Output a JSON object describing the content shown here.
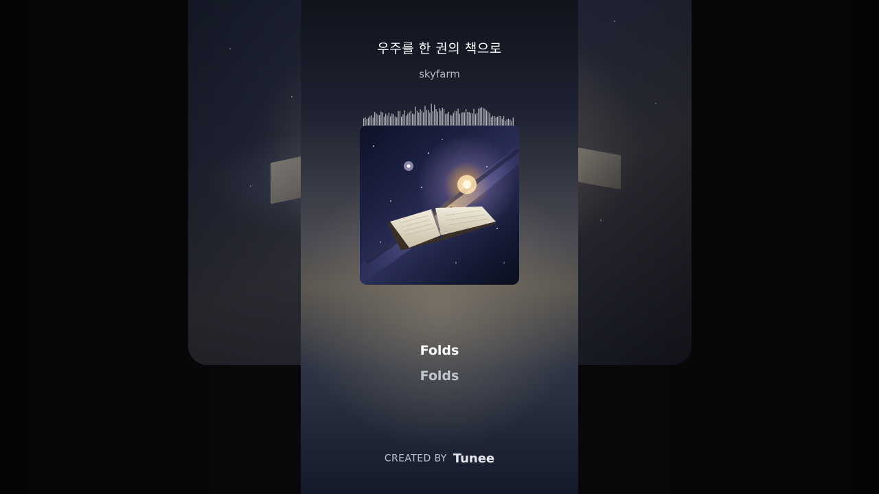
{
  "song": {
    "title": "우주를 한 권의 책으로",
    "artist": "skyfarm"
  },
  "cover": {
    "icon": "galaxy-book-artwork"
  },
  "lyrics": {
    "current": "Folds",
    "next": "Folds"
  },
  "credit": {
    "prefix": "CREATED BY",
    "brand": "Tunee"
  },
  "colors": {
    "text_primary": "#ffffff",
    "text_secondary": "#b7bac4",
    "waveform": "#c9ccd4"
  }
}
